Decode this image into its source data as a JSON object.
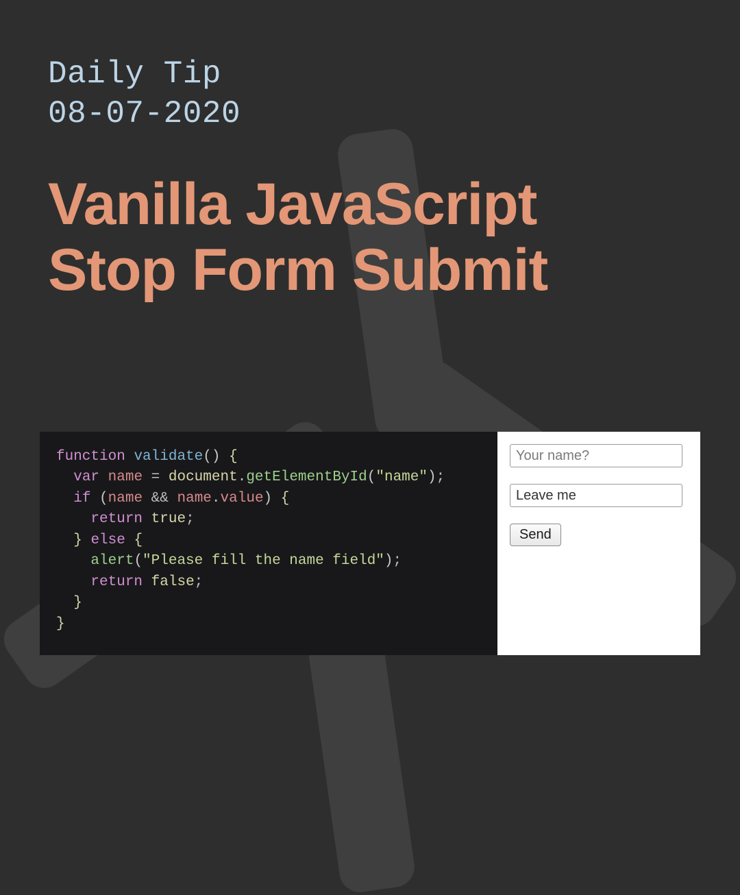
{
  "header": {
    "eyebrow_line1": "Daily Tip",
    "eyebrow_line2": "08-07-2020",
    "headline_line1": "Vanilla JavaScript",
    "headline_line2": "Stop Form Submit"
  },
  "code": {
    "t_function": "function",
    "t_validate": "validate",
    "t_lpar": "(",
    "t_rpar": ")",
    "t_lbrace": "{",
    "t_rbrace": "}",
    "t_var": "var",
    "t_name": "name",
    "t_eq": " = ",
    "t_document": "document",
    "t_dot": ".",
    "t_gebi": "getElementById",
    "t_str_name": "\"name\"",
    "t_semi": ";",
    "t_if": "if",
    "t_and": " && ",
    "t_value": "value",
    "t_return": "return",
    "t_true": "true",
    "t_else": "else",
    "t_alert": "alert",
    "t_str_msg": "\"Please fill the name field\"",
    "t_false": "false"
  },
  "form": {
    "name_placeholder": "Your name?",
    "extra_value": "Leave me",
    "send_label": "Send"
  }
}
